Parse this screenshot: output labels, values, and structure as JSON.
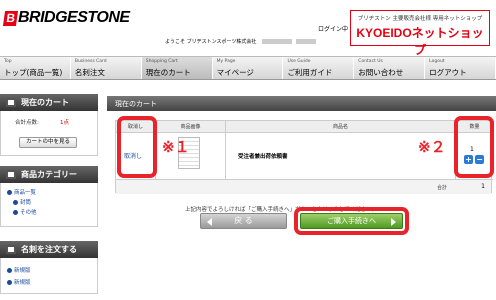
{
  "header": {
    "brand": "BRIDGESTONE",
    "login_label": "ログイン中",
    "welcome_text": "ようこそ ブリヂストンスポーツ株式会社",
    "shop_sub": "ブリヂストン 主要販売会社様 専用ネットショップ",
    "shop_name": "KYOEIDOネットショップ"
  },
  "nav": [
    {
      "en": "Top",
      "ja": "トップ(商品一覧)"
    },
    {
      "en": "Business Card",
      "ja": "名刺注文"
    },
    {
      "en": "Shopping Cart",
      "ja": "現在のカート"
    },
    {
      "en": "My Page",
      "ja": "マイページ"
    },
    {
      "en": "Use Guide",
      "ja": "ご利用ガイド"
    },
    {
      "en": "Contact Us",
      "ja": "お問い合わせ"
    },
    {
      "en": "Logout",
      "ja": "ログアウト"
    }
  ],
  "sidebar": {
    "cart": {
      "title": "現在のカート",
      "total_label": "合計点数:",
      "total_value": "1点",
      "view_button": "カートの中を見る"
    },
    "category": {
      "title": "商品カテゴリー",
      "items": [
        "商品一覧",
        "封筒",
        "その他"
      ]
    },
    "order": {
      "title": "名刺を注文する",
      "items": [
        "新規版",
        "新規版"
      ]
    }
  },
  "main": {
    "title": "現在のカート",
    "columns": {
      "cancel": "取消し",
      "image": "商品画像",
      "name": "商品名",
      "qty": "数量"
    },
    "row": {
      "cancel_link": "取消し",
      "product_name": "受注者兼出荷依頼書",
      "quantity": "1",
      "plus": "+",
      "minus": "−"
    },
    "total_label": "合計",
    "total_value": "1",
    "note": "上記内容でよろしければ「ご購入手続きへ」ボタンをクリックしてください。",
    "back_button": "戻 る",
    "buy_button": "ご購入手続きへ"
  },
  "annotations": {
    "mark1": "※１",
    "mark2": "※２",
    "color": "#e8242a"
  }
}
